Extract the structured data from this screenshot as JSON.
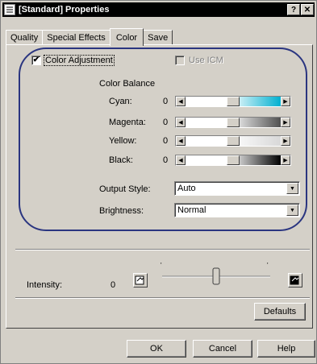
{
  "window": {
    "title": "[Standard] Properties",
    "help_label": "?",
    "close_label": "✕"
  },
  "tabs": [
    {
      "label": "Quality"
    },
    {
      "label": "Special Effects"
    },
    {
      "label": "Color",
      "active": true
    },
    {
      "label": "Save"
    }
  ],
  "color_adjustment": {
    "label": "Color Adjustment",
    "checked": true,
    "check_glyph": "✔"
  },
  "use_icm": {
    "label": "Use ICM",
    "checked": false,
    "enabled": false
  },
  "color_balance": {
    "heading": "Color Balance",
    "sliders": [
      {
        "label": "Cyan:",
        "value": "0",
        "level": 0.5,
        "gradient": "#00b0d0"
      },
      {
        "label": "Magenta:",
        "value": "0",
        "level": 0.5,
        "gradient": "#505050"
      },
      {
        "label": "Yellow:",
        "value": "0",
        "level": 0.5,
        "gradient": "#d8d8d8"
      },
      {
        "label": "Black:",
        "value": "0",
        "level": 0.5,
        "gradient": "#000000"
      }
    ],
    "left_arrow": "◀",
    "right_arrow": "▶"
  },
  "output_style": {
    "label": "Output Style:",
    "value": "Auto"
  },
  "brightness": {
    "label": "Brightness:",
    "value": "Normal"
  },
  "combo_arrow": "▼",
  "intensity": {
    "label": "Intensity:",
    "value": "0",
    "level": 0.5
  },
  "buttons": {
    "defaults": "Defaults",
    "ok": "OK",
    "cancel": "Cancel",
    "help": "Help"
  },
  "colors": {
    "highlight_oval": "#2a3580",
    "face": "#d4d0c8"
  }
}
